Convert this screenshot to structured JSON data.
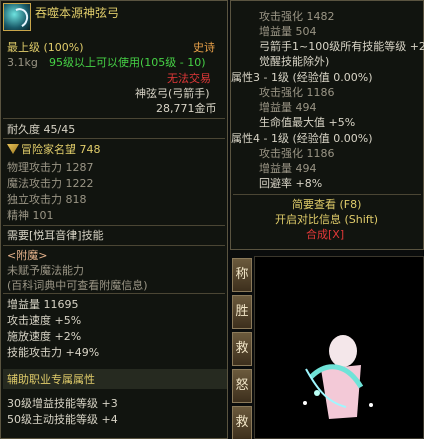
{
  "item": {
    "name": "吞噬本源神弦弓",
    "level_label": "最上级",
    "level_pct": "(100%)",
    "rarity": "史诗",
    "weight": "3.1kg",
    "usage": "95级以上可以使用(105级 - 10)",
    "trade": "无法交易",
    "type": "神弦弓(弓箭手)",
    "price": "28,771金币",
    "durability": "耐久度 45/45",
    "adventurer_fame": "冒险家名望 748",
    "stats": [
      "物理攻击力 1287",
      "魔法攻击力 1222",
      "独立攻击力 818",
      "精神 101"
    ],
    "requirement": "需要[悦耳音律]技能",
    "enchant_header": "<附魔>",
    "enchant_none": "未赋予魔法能力",
    "enchant_hint": "(百科词典中可查看附魔信息)",
    "bonus": [
      "增益量 11695",
      "攻击速度 +5%",
      "施放速度 +2%",
      "技能攻击力 +49%"
    ],
    "support_header": "辅助职业专属属性",
    "support": [
      "30级增益技能等级 +3",
      "50级主动技能等级 +4"
    ]
  },
  "detail": {
    "lines": [
      "攻击强化 1482",
      "增益量 504",
      "弓箭手1~100级所有技能等级 +2",
      "觉醒技能除外)",
      "属性3 - 1级 (经验值 0.00%)",
      "攻击强化 1186",
      "增益量 494",
      "生命值最大值 +5%",
      "属性4 - 1级 (经验值 0.00%)",
      "攻击强化 1186",
      "增益量 494",
      "回避率 +8%"
    ],
    "simple_view": "简要查看 (F8)",
    "compare": "开启对比信息 (Shift)",
    "compose": "合成[X]"
  },
  "tabs": [
    "称",
    "胜",
    "救",
    "怒",
    "救"
  ]
}
